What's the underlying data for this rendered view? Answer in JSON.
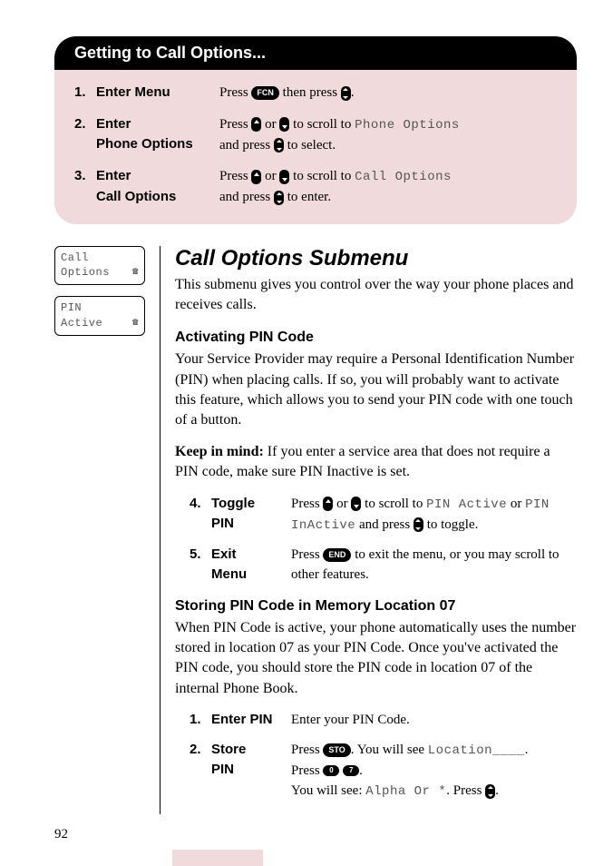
{
  "panel": {
    "header": "Getting to Call Options...",
    "steps": [
      {
        "num": "1.",
        "label": "Enter Menu",
        "pre": "Press ",
        "key1": "FCN",
        "mid": " then press ",
        "key2_type": "updown",
        "post": "."
      },
      {
        "num": "2.",
        "label_l1": "Enter",
        "label_l2": "Phone Options",
        "pre": "Press ",
        "k_up": "up",
        "or1": " or ",
        "k_down": "down",
        "scroll": " to scroll to ",
        "lcd": "Phone Options",
        "line2_pre": "and press ",
        "line2_key": "updown",
        "line2_post": " to select."
      },
      {
        "num": "3.",
        "label_l1": "Enter",
        "label_l2": "Call Options",
        "pre": "Press ",
        "k_up": "up",
        "or1": " or ",
        "k_down": "down",
        "scroll": " to scroll to ",
        "lcd": "Call Options",
        "line2_pre": "and press ",
        "line2_key": "updown",
        "line2_post": " to enter."
      }
    ]
  },
  "lcd_boxes": [
    {
      "l1": "Call",
      "l2": "Options"
    },
    {
      "l1": "PIN",
      "l2": "Active"
    }
  ],
  "main": {
    "title": "Call Options Submenu",
    "intro": "This submenu gives you control over the way your phone places and receives calls.",
    "pin_head": "Activating PIN Code",
    "pin_body": "Your Service Provider may require a Personal Identification Number (PIN) when placing calls. If so, you will probably want to activate this feature, which allows you to send your PIN code with one touch of a button.",
    "keep_label": "Keep in mind:",
    "keep_body": " If you enter a service area that does not require a PIN code, make sure PIN Inactive is set.",
    "steps_a": [
      {
        "num": "4.",
        "label_l1": "Toggle",
        "label_l2": "PIN",
        "pre": "Press ",
        "or": " or ",
        "scroll": " to scroll to ",
        "lcd1": "PIN Active",
        "or2": " or ",
        "lcd2": "PIN InActive",
        "mid2": " and press ",
        "post": " to toggle."
      },
      {
        "num": "5.",
        "label_l1": "Exit",
        "label_l2": "Menu",
        "pre": "Press ",
        "key": "END",
        "post": " to exit the menu, or you may scroll to other features."
      }
    ],
    "store_head": "Storing PIN Code in Memory Location 07",
    "store_body": "When PIN Code is active, your phone automatically uses the number stored in location 07 as your PIN Code. Once you've activated the PIN code, you should store the PIN code in location 07 of the internal Phone Book.",
    "steps_b": [
      {
        "num": "1.",
        "label": "Enter PIN",
        "desc": "Enter your PIN Code."
      },
      {
        "num": "2.",
        "label_l1": "Store",
        "label_l2": "PIN",
        "l1_pre": "Press ",
        "l1_key": "STO",
        "l1_mid": ". You will see ",
        "l1_lcd": "Location____",
        "l1_post": ".",
        "l2_pre": "Press ",
        "l2_k1": "0",
        "l2_k2": "7",
        "l2_post": ".",
        "l3_pre": "You will see: ",
        "l3_lcd": "Alpha Or *",
        "l3_mid": ". Press ",
        "l3_post": "."
      }
    ]
  },
  "page_number": "92"
}
